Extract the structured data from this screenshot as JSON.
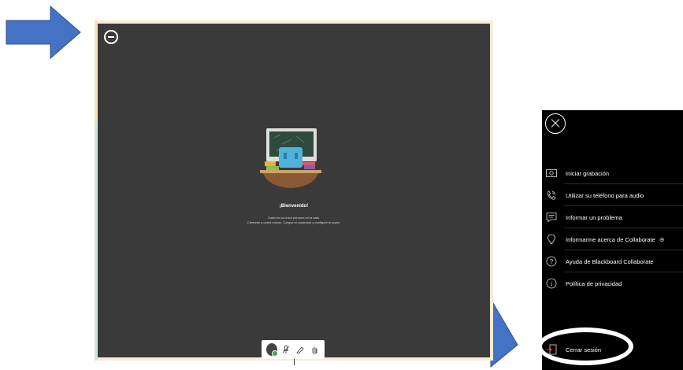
{
  "colors": {
    "arrow": "#4472c4",
    "stage": "#3a3a3a",
    "menu_bg": "#000000",
    "status_green": "#3aa655"
  },
  "session": {
    "collapse_icon": "minus-circle-icon",
    "welcome_title": "¡Bienvenido!",
    "welcome_line1": "Usted es la única persona en la sala.",
    "welcome_line2": "Céntrese a usted mismo. Cargue el contenido y configure el audio."
  },
  "toolbar": {
    "items": [
      "avatar",
      "mic-off-icon",
      "pen-icon",
      "hand-icon"
    ]
  },
  "menu": {
    "close_icon": "close-icon",
    "items": [
      {
        "icon": "record-icon",
        "label": "Iniciar grabación"
      },
      {
        "icon": "phone-icon",
        "label": "Utilizar su teléfono para audio"
      },
      {
        "icon": "report-icon",
        "label": "Informar un problema"
      },
      {
        "icon": "lightbulb-icon",
        "label": "Informarme acerca de Collaborate"
      },
      {
        "icon": "help-icon",
        "label": "Ayuda de Blackboard Collaborate"
      },
      {
        "icon": "info-icon",
        "label": "Política de privacidad"
      }
    ],
    "logout": {
      "icon": "logout-icon",
      "label": "Cerrar sesión"
    }
  }
}
